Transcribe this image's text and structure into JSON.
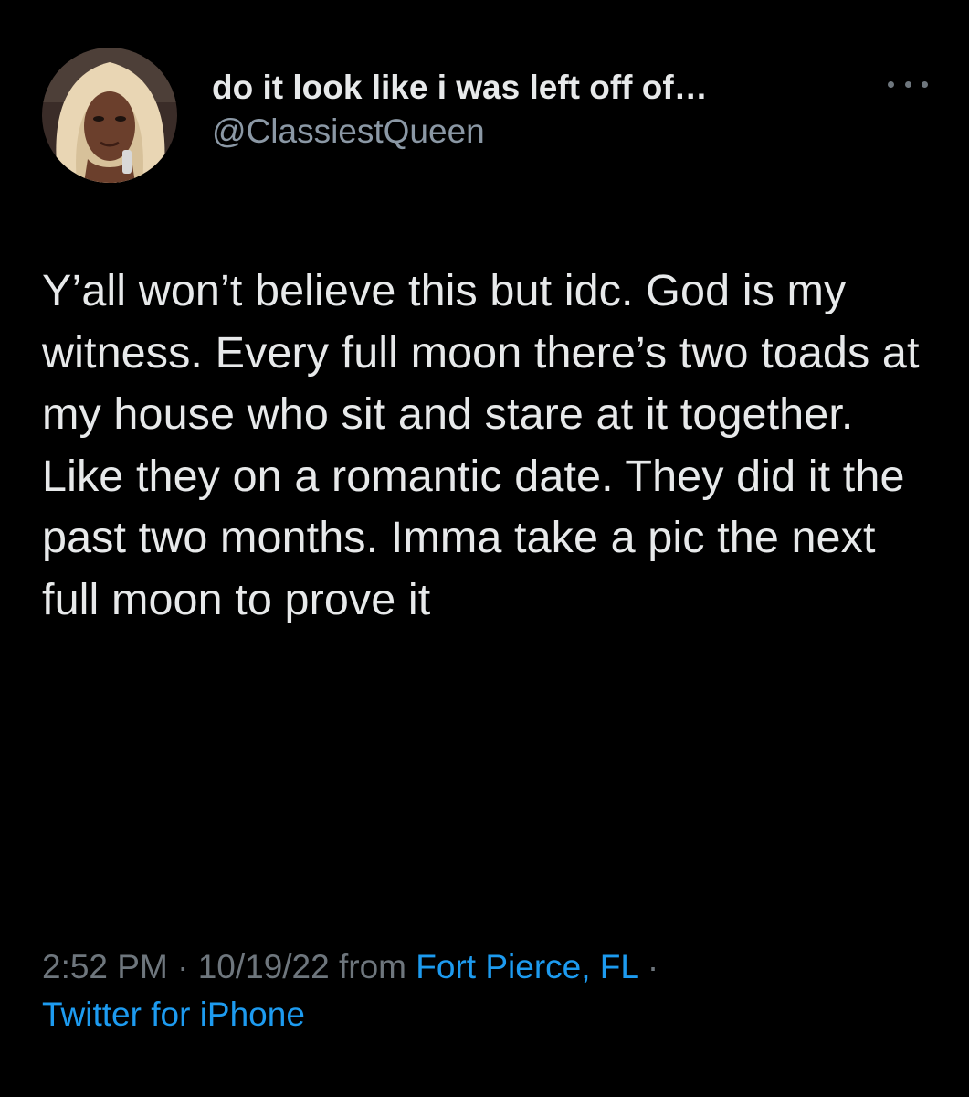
{
  "tweet": {
    "author": {
      "display_name": "do it look like i was left off of…",
      "handle": "@ClassiestQueen",
      "avatar_icon": "profile-photo"
    },
    "more_icon": "more-dots-icon",
    "text": "Y’all won’t believe this but idc. God is my witness. Every full moon there’s two toads at my house who sit and stare at it together. Like they on a romantic date. They did it the past two months. Imma take a pic the next full moon to prove it",
    "time": "2:52 PM",
    "separator": " · ",
    "date": "10/19/22",
    "from_label": " from ",
    "location": "Fort Pierce, FL",
    "client": "Twitter for iPhone"
  },
  "colors": {
    "background": "#000000",
    "text_primary": "#e7e9ea",
    "text_secondary": "#6e767d",
    "link": "#1d9bf0"
  }
}
